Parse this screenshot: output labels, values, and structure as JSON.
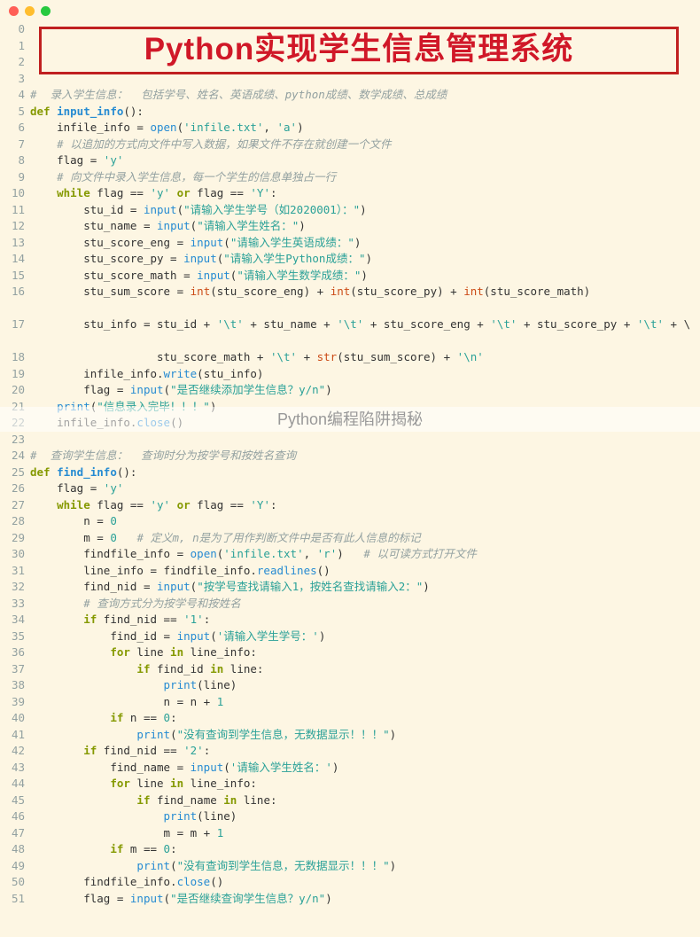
{
  "window": {
    "dots": [
      "red",
      "yellow",
      "green"
    ]
  },
  "banner": "Python实现学生信息管理系统",
  "watermark": "Python编程陷阱揭秘",
  "gutter_start": 0,
  "gutter_end": 51,
  "code_lines": [
    {
      "n": 0,
      "raw": ""
    },
    {
      "n": 1,
      "raw": ""
    },
    {
      "n": 2,
      "raw": ""
    },
    {
      "n": 3,
      "raw": ""
    },
    {
      "n": 4,
      "spans": [
        [
          "cmt",
          "#  录入学生信息：  包括学号、姓名、英语成绩、python成绩、数学成绩、总成绩"
        ]
      ]
    },
    {
      "n": 5,
      "spans": [
        [
          "kw",
          "def "
        ],
        [
          "def-name",
          "input_info"
        ],
        [
          "op",
          "():"
        ]
      ]
    },
    {
      "n": 6,
      "spans": [
        [
          "op",
          "    infile_info = "
        ],
        [
          "fn",
          "open"
        ],
        [
          "op",
          "("
        ],
        [
          "str",
          "'infile.txt'"
        ],
        [
          "op",
          ", "
        ],
        [
          "str",
          "'a'"
        ],
        [
          "op",
          ")"
        ]
      ]
    },
    {
      "n": 7,
      "spans": [
        [
          "op",
          "    "
        ],
        [
          "cmt",
          "# 以追加的方式向文件中写入数据，如果文件不存在就创建一个文件"
        ]
      ]
    },
    {
      "n": 8,
      "spans": [
        [
          "op",
          "    flag = "
        ],
        [
          "str",
          "'y'"
        ]
      ]
    },
    {
      "n": 9,
      "spans": [
        [
          "op",
          "    "
        ],
        [
          "cmt",
          "# 向文件中录入学生信息，每一个学生的信息单独占一行"
        ]
      ]
    },
    {
      "n": 10,
      "spans": [
        [
          "op",
          "    "
        ],
        [
          "kw",
          "while"
        ],
        [
          "op",
          " flag == "
        ],
        [
          "str",
          "'y'"
        ],
        [
          "op",
          " "
        ],
        [
          "kw",
          "or"
        ],
        [
          "op",
          " flag == "
        ],
        [
          "str",
          "'Y'"
        ],
        [
          "op",
          ":"
        ]
      ]
    },
    {
      "n": 11,
      "spans": [
        [
          "op",
          "        stu_id = "
        ],
        [
          "fn",
          "input"
        ],
        [
          "op",
          "("
        ],
        [
          "str",
          "\"请输入学生学号（如2020001）：\""
        ],
        [
          "op",
          ")"
        ]
      ]
    },
    {
      "n": 12,
      "spans": [
        [
          "op",
          "        stu_name = "
        ],
        [
          "fn",
          "input"
        ],
        [
          "op",
          "("
        ],
        [
          "str",
          "\"请输入学生姓名：\""
        ],
        [
          "op",
          ")"
        ]
      ]
    },
    {
      "n": 13,
      "spans": [
        [
          "op",
          "        stu_score_eng = "
        ],
        [
          "fn",
          "input"
        ],
        [
          "op",
          "("
        ],
        [
          "str",
          "\"请输入学生英语成绩：\""
        ],
        [
          "op",
          ")"
        ]
      ]
    },
    {
      "n": 14,
      "spans": [
        [
          "op",
          "        stu_score_py = "
        ],
        [
          "fn",
          "input"
        ],
        [
          "op",
          "("
        ],
        [
          "str",
          "\"请输入学生Python成绩：\""
        ],
        [
          "op",
          ")"
        ]
      ]
    },
    {
      "n": 15,
      "spans": [
        [
          "op",
          "        stu_score_math = "
        ],
        [
          "fn",
          "input"
        ],
        [
          "op",
          "("
        ],
        [
          "str",
          "\"请输入学生数学成绩：\""
        ],
        [
          "op",
          ")"
        ]
      ]
    },
    {
      "n": 16,
      "wrap": true,
      "spans": [
        [
          "op",
          "        stu_sum_score = "
        ],
        [
          "builtin",
          "int"
        ],
        [
          "op",
          "(stu_score_eng) + "
        ],
        [
          "builtin",
          "int"
        ],
        [
          "op",
          "(stu_score_py) + "
        ],
        [
          "builtin",
          "int"
        ],
        [
          "op",
          "(stu_score_math)"
        ]
      ]
    },
    {
      "n": 17,
      "wrap": true,
      "spans": [
        [
          "op",
          "        stu_info = stu_id + "
        ],
        [
          "str",
          "'\\t'"
        ],
        [
          "op",
          " + stu_name + "
        ],
        [
          "str",
          "'\\t'"
        ],
        [
          "op",
          " + stu_score_eng + "
        ],
        [
          "str",
          "'\\t'"
        ],
        [
          "op",
          " + stu_score_py + "
        ],
        [
          "str",
          "'\\t'"
        ],
        [
          "op",
          " + \\"
        ]
      ]
    },
    {
      "n": 18,
      "spans": [
        [
          "op",
          "                   stu_score_math + "
        ],
        [
          "str",
          "'\\t'"
        ],
        [
          "op",
          " + "
        ],
        [
          "builtin",
          "str"
        ],
        [
          "op",
          "(stu_sum_score) + "
        ],
        [
          "str",
          "'\\n'"
        ]
      ]
    },
    {
      "n": 19,
      "spans": [
        [
          "op",
          "        infile_info."
        ],
        [
          "fn",
          "write"
        ],
        [
          "op",
          "(stu_info)"
        ]
      ]
    },
    {
      "n": 20,
      "spans": [
        [
          "op",
          "        flag = "
        ],
        [
          "fn",
          "input"
        ],
        [
          "op",
          "("
        ],
        [
          "str",
          "\"是否继续添加学生信息？y/n\""
        ],
        [
          "op",
          ")"
        ]
      ]
    },
    {
      "n": 21,
      "spans": [
        [
          "op",
          "    "
        ],
        [
          "fn",
          "print"
        ],
        [
          "op",
          "("
        ],
        [
          "str",
          "\"信息录入完毕！！！\""
        ],
        [
          "op",
          ")"
        ]
      ]
    },
    {
      "n": 22,
      "spans": [
        [
          "op",
          "    infile_info."
        ],
        [
          "fn",
          "close"
        ],
        [
          "op",
          "()"
        ]
      ]
    },
    {
      "n": 23,
      "raw": ""
    },
    {
      "n": 24,
      "spans": [
        [
          "cmt",
          "#  查询学生信息：  查询时分为按学号和按姓名查询"
        ]
      ]
    },
    {
      "n": 25,
      "spans": [
        [
          "kw",
          "def "
        ],
        [
          "def-name",
          "find_info"
        ],
        [
          "op",
          "():"
        ]
      ]
    },
    {
      "n": 26,
      "spans": [
        [
          "op",
          "    flag = "
        ],
        [
          "str",
          "'y'"
        ]
      ]
    },
    {
      "n": 27,
      "spans": [
        [
          "op",
          "    "
        ],
        [
          "kw",
          "while"
        ],
        [
          "op",
          " flag == "
        ],
        [
          "str",
          "'y'"
        ],
        [
          "op",
          " "
        ],
        [
          "kw",
          "or"
        ],
        [
          "op",
          " flag == "
        ],
        [
          "str",
          "'Y'"
        ],
        [
          "op",
          ":"
        ]
      ]
    },
    {
      "n": 28,
      "spans": [
        [
          "op",
          "        n = "
        ],
        [
          "num",
          "0"
        ]
      ]
    },
    {
      "n": 29,
      "spans": [
        [
          "op",
          "        m = "
        ],
        [
          "num",
          "0"
        ],
        [
          "op",
          "   "
        ],
        [
          "cmt",
          "# 定义m, n是为了用作判断文件中是否有此人信息的标记"
        ]
      ]
    },
    {
      "n": 30,
      "spans": [
        [
          "op",
          "        findfile_info = "
        ],
        [
          "fn",
          "open"
        ],
        [
          "op",
          "("
        ],
        [
          "str",
          "'infile.txt'"
        ],
        [
          "op",
          ", "
        ],
        [
          "str",
          "'r'"
        ],
        [
          "op",
          ")   "
        ],
        [
          "cmt",
          "# 以可读方式打开文件"
        ]
      ]
    },
    {
      "n": 31,
      "spans": [
        [
          "op",
          "        line_info = findfile_info."
        ],
        [
          "fn",
          "readlines"
        ],
        [
          "op",
          "()"
        ]
      ]
    },
    {
      "n": 32,
      "spans": [
        [
          "op",
          "        find_nid = "
        ],
        [
          "fn",
          "input"
        ],
        [
          "op",
          "("
        ],
        [
          "str",
          "\"按学号查找请输入1，按姓名查找请输入2：\""
        ],
        [
          "op",
          ")"
        ]
      ]
    },
    {
      "n": 33,
      "spans": [
        [
          "op",
          "        "
        ],
        [
          "cmt",
          "# 查询方式分为按学号和按姓名"
        ]
      ]
    },
    {
      "n": 34,
      "spans": [
        [
          "op",
          "        "
        ],
        [
          "kw",
          "if"
        ],
        [
          "op",
          " find_nid == "
        ],
        [
          "str",
          "'1'"
        ],
        [
          "op",
          ":"
        ]
      ]
    },
    {
      "n": 35,
      "spans": [
        [
          "op",
          "            find_id = "
        ],
        [
          "fn",
          "input"
        ],
        [
          "op",
          "("
        ],
        [
          "str",
          "'请输入学生学号：'"
        ],
        [
          "op",
          ")"
        ]
      ]
    },
    {
      "n": 36,
      "spans": [
        [
          "op",
          "            "
        ],
        [
          "kw",
          "for"
        ],
        [
          "op",
          " line "
        ],
        [
          "kw",
          "in"
        ],
        [
          "op",
          " line_info:"
        ]
      ]
    },
    {
      "n": 37,
      "spans": [
        [
          "op",
          "                "
        ],
        [
          "kw",
          "if"
        ],
        [
          "op",
          " find_id "
        ],
        [
          "kw",
          "in"
        ],
        [
          "op",
          " line:"
        ]
      ]
    },
    {
      "n": 38,
      "spans": [
        [
          "op",
          "                    "
        ],
        [
          "fn",
          "print"
        ],
        [
          "op",
          "(line)"
        ]
      ]
    },
    {
      "n": 39,
      "spans": [
        [
          "op",
          "                    n = n + "
        ],
        [
          "num",
          "1"
        ]
      ]
    },
    {
      "n": 40,
      "spans": [
        [
          "op",
          "            "
        ],
        [
          "kw",
          "if"
        ],
        [
          "op",
          " n == "
        ],
        [
          "num",
          "0"
        ],
        [
          "op",
          ":"
        ]
      ]
    },
    {
      "n": 41,
      "spans": [
        [
          "op",
          "                "
        ],
        [
          "fn",
          "print"
        ],
        [
          "op",
          "("
        ],
        [
          "str",
          "\"没有查询到学生信息，无数据显示！！！\""
        ],
        [
          "op",
          ")"
        ]
      ]
    },
    {
      "n": 42,
      "spans": [
        [
          "op",
          "        "
        ],
        [
          "kw",
          "if"
        ],
        [
          "op",
          " find_nid == "
        ],
        [
          "str",
          "'2'"
        ],
        [
          "op",
          ":"
        ]
      ]
    },
    {
      "n": 43,
      "spans": [
        [
          "op",
          "            find_name = "
        ],
        [
          "fn",
          "input"
        ],
        [
          "op",
          "("
        ],
        [
          "str",
          "'请输入学生姓名：'"
        ],
        [
          "op",
          ")"
        ]
      ]
    },
    {
      "n": 44,
      "spans": [
        [
          "op",
          "            "
        ],
        [
          "kw",
          "for"
        ],
        [
          "op",
          " line "
        ],
        [
          "kw",
          "in"
        ],
        [
          "op",
          " line_info:"
        ]
      ]
    },
    {
      "n": 45,
      "spans": [
        [
          "op",
          "                "
        ],
        [
          "kw",
          "if"
        ],
        [
          "op",
          " find_name "
        ],
        [
          "kw",
          "in"
        ],
        [
          "op",
          " line:"
        ]
      ]
    },
    {
      "n": 46,
      "spans": [
        [
          "op",
          "                    "
        ],
        [
          "fn",
          "print"
        ],
        [
          "op",
          "(line)"
        ]
      ]
    },
    {
      "n": 47,
      "spans": [
        [
          "op",
          "                    m = m + "
        ],
        [
          "num",
          "1"
        ]
      ]
    },
    {
      "n": 48,
      "spans": [
        [
          "op",
          "            "
        ],
        [
          "kw",
          "if"
        ],
        [
          "op",
          " m == "
        ],
        [
          "num",
          "0"
        ],
        [
          "op",
          ":"
        ]
      ]
    },
    {
      "n": 49,
      "spans": [
        [
          "op",
          "                "
        ],
        [
          "fn",
          "print"
        ],
        [
          "op",
          "("
        ],
        [
          "str",
          "\"没有查询到学生信息，无数据显示！！！\""
        ],
        [
          "op",
          ")"
        ]
      ]
    },
    {
      "n": 50,
      "spans": [
        [
          "op",
          "        findfile_info."
        ],
        [
          "fn",
          "close"
        ],
        [
          "op",
          "()"
        ]
      ]
    },
    {
      "n": 51,
      "spans": [
        [
          "op",
          "        flag = "
        ],
        [
          "fn",
          "input"
        ],
        [
          "op",
          "("
        ],
        [
          "str",
          "\"是否继续查询学生信息？y/n\""
        ],
        [
          "op",
          ")"
        ]
      ]
    }
  ]
}
